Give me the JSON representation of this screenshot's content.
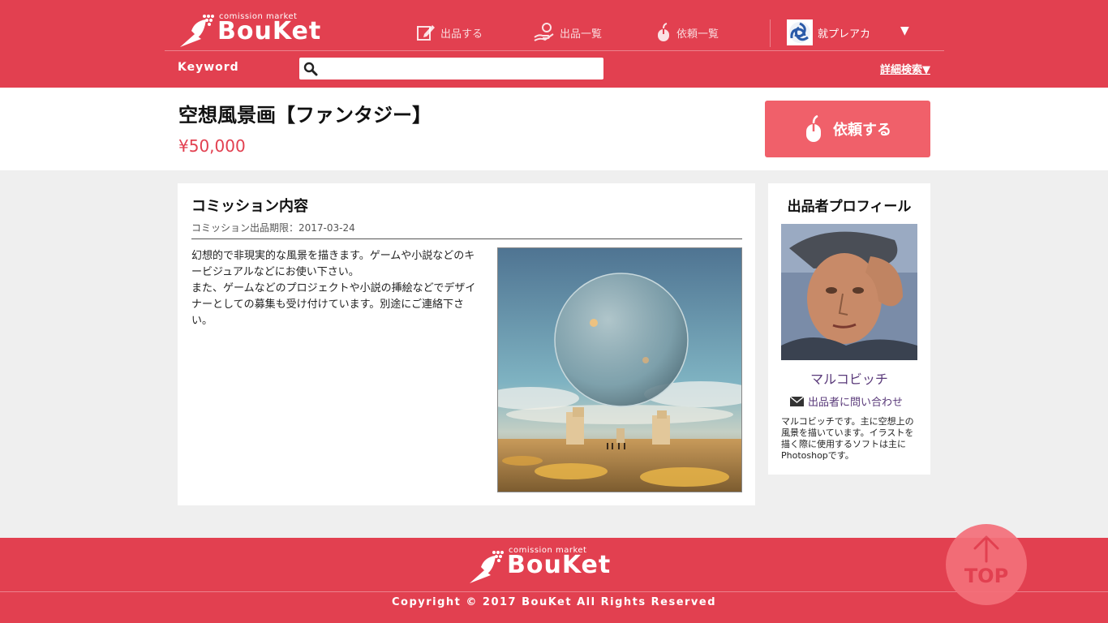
{
  "header": {
    "logo_sub": "comission market",
    "logo_main": "BouKet",
    "nav": [
      {
        "label": "出品する",
        "icon": "edit-icon"
      },
      {
        "label": "出品一覧",
        "icon": "hand-icon"
      },
      {
        "label": "依頼一覧",
        "icon": "mouse-icon"
      }
    ],
    "user_name": "就プレアカ",
    "keyword_label": "Keyword",
    "search_placeholder": "",
    "detail_search": "詳細検索▼"
  },
  "item": {
    "title": "空想風景画【ファンタジー】",
    "price": "¥50,000",
    "request_button": "依頼する"
  },
  "commission": {
    "heading": "コミッション内容",
    "deadline_label": "コミッション出品期限：",
    "deadline_value": "2017-03-24",
    "description_lines": [
      "幻想的で非現実的な風景を描きます。ゲームや小説などのキービジュアルなどにお使い下さい。",
      "また、ゲームなどのプロジェクトや小説の挿絵などでデザイナーとしての募集も受け付けています。別途にご連絡下さい。"
    ]
  },
  "profile": {
    "heading": "出品者プロフィール",
    "name": "マルコビッチ",
    "contact": "出品者に問い合わせ",
    "bio": "マルコビッチです。主に空想上の風景を描いています。イラストを描く際に使用するソフトは主にPhotoshopです。"
  },
  "footer": {
    "logo_sub": "comission market",
    "logo_main": "BouKet",
    "copyright": "Copyright © 2017 BouKet All Rights Reserved"
  },
  "top_button": {
    "label": "TOP"
  },
  "colors": {
    "brand": "#e24050",
    "button": "#f0606a",
    "link": "#5a3a7a"
  }
}
